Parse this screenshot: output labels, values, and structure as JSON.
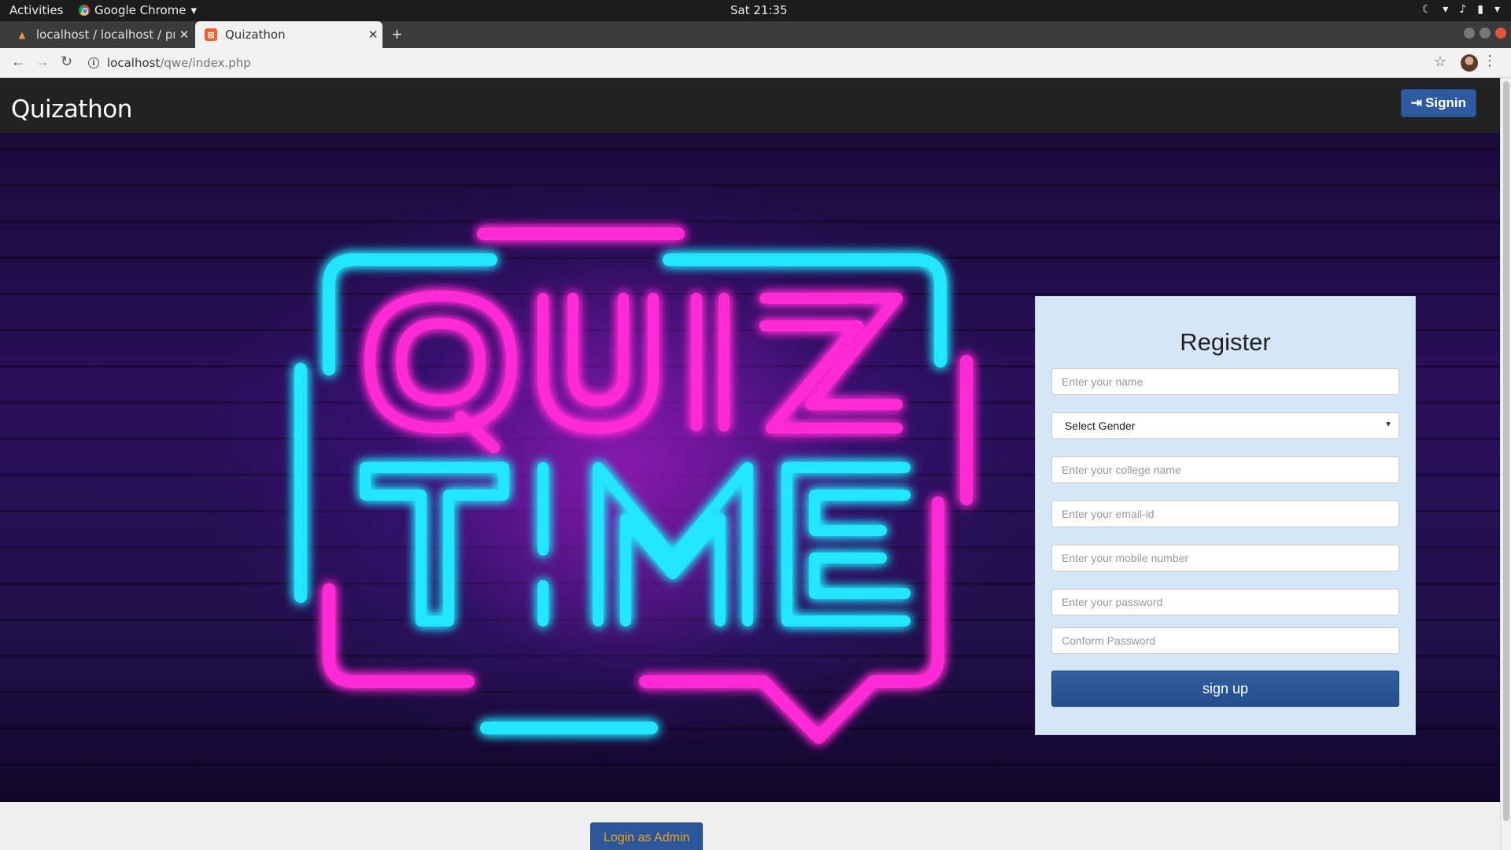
{
  "system": {
    "activities": "Activities",
    "app": "Google Chrome",
    "clock": "Sat 21:35"
  },
  "tabs": [
    {
      "title": "localhost / localhost / pro",
      "active": false
    },
    {
      "title": "Quizathon",
      "active": true
    }
  ],
  "address": {
    "host": "localhost",
    "path": "/qwe/index.php"
  },
  "navbar": {
    "brand": "Quizathon",
    "signin_label": "Signin"
  },
  "hero": {
    "line1": "QUIZ",
    "line2": "TIME",
    "colors": {
      "pink": "#ff2bd6",
      "cyan": "#22e6ff"
    }
  },
  "register": {
    "title": "Register",
    "fields": {
      "name": "Enter your name",
      "gender": "Select Gender",
      "college": "Enter your college name",
      "email": "Enter your email-id",
      "mobile": "Enter your mobile number",
      "password": "Enter your password",
      "confirm": "Conform Password"
    },
    "submit_label": "sign up"
  },
  "footer": {
    "admin_label": "Login as Admin"
  }
}
